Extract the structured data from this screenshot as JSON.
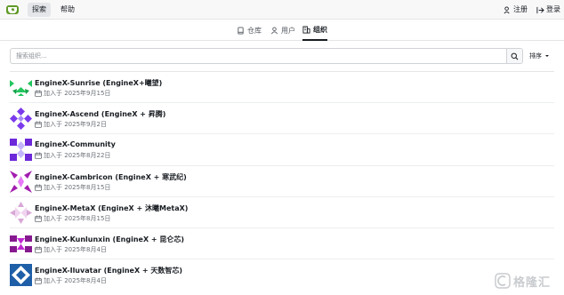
{
  "navbar": {
    "explore_label": "探索",
    "help_label": "帮助",
    "register_label": "注册",
    "login_label": "登录"
  },
  "subtabs": {
    "repos_label": "仓库",
    "users_label": "用户",
    "orgs_label": "组织"
  },
  "search": {
    "placeholder": "搜索组织...",
    "value": "",
    "sort_label": "排序"
  },
  "orgs": [
    {
      "name": "EngineX-Sunrise (EngineX+曦望)",
      "joined": "加入于 2025年9月15日",
      "color": "#22c55e"
    },
    {
      "name": "EngineX-Ascend (EngineX + 昇腾)",
      "joined": "加入于 2025年9月2日",
      "color": "#7c3aed"
    },
    {
      "name": "EngineX-Community",
      "joined": "加入于 2025年8月22日",
      "color": "#6d28d9"
    },
    {
      "name": "EngineX-Cambricon (EngineX + 寒武纪)",
      "joined": "加入于 2025年8月15日",
      "color": "#a21caf"
    },
    {
      "name": "EngineX-MetaX (EngineX + 沐曦MetaX)",
      "joined": "加入于 2025年8月15日",
      "color": "#d8a7d6"
    },
    {
      "name": "EngineX-Kunlunxin (EngineX + 昆仑芯)",
      "joined": "加入于 2025年8月4日",
      "color": "#86198f"
    },
    {
      "name": "EngineX-Iluvatar (EngineX + 天数智芯)",
      "joined": "加入于 2025年8月4日",
      "color": "#1e5fa8"
    }
  ],
  "watermark": {
    "text": "格隆汇"
  },
  "colors": {
    "brand": "#609926",
    "text": "#181c21",
    "muted": "#6a6f76",
    "border": "#e4e5e7"
  }
}
